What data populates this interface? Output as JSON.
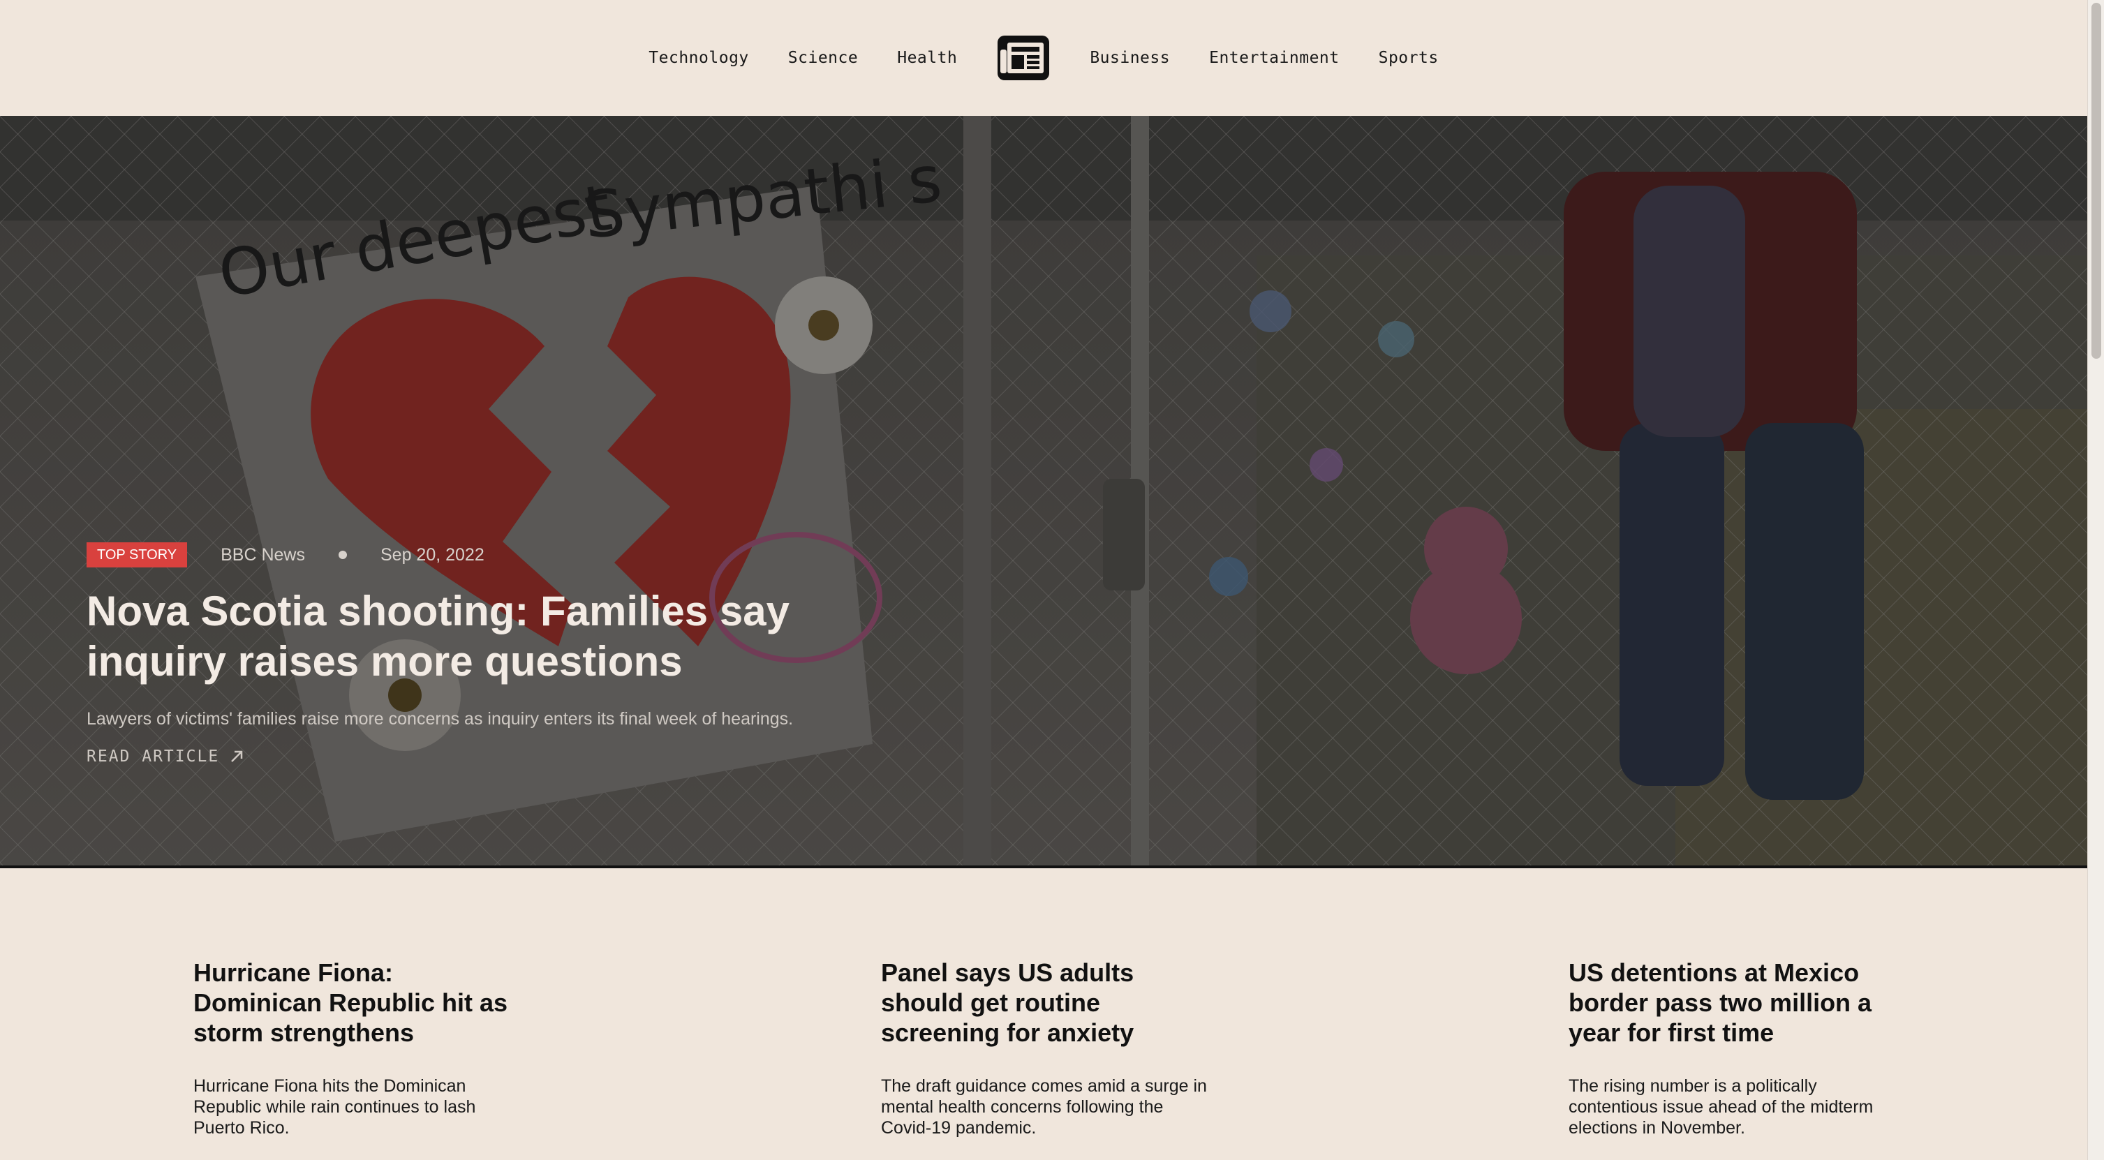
{
  "nav": {
    "left_items": [
      "Technology",
      "Science",
      "Health"
    ],
    "right_items": [
      "Business",
      "Entertainment",
      "Sports"
    ],
    "logo_icon": "newspaper-icon"
  },
  "hero": {
    "badge": "TOP STORY",
    "source": "BBC News",
    "date": "Sep 20, 2022",
    "title": "Nova Scotia shooting: Families say inquiry raises more questions",
    "description": "Lawyers of victims' families raise more concerns as inquiry enters its final week of hearings.",
    "read_label": "READ ARTICLE",
    "read_icon": "arrow-up-right-icon",
    "sign_text_1": "Our deepest",
    "sign_text_2": "Sympathies",
    "badge_color": "#d9413e"
  },
  "articles": [
    {
      "title": "Hurricane Fiona: Dominican Republic hit as storm strengthens",
      "description": "Hurricane Fiona hits the Dominican Republic while rain continues to lash Puerto Rico."
    },
    {
      "title": "Panel says US adults should get routine screening for anxiety",
      "description": "The draft guidance comes amid a surge in mental health concerns following the Covid-19 pandemic."
    },
    {
      "title": "US detentions at Mexico border pass two million a year for first time",
      "description": "The rising number is a politically contentious issue ahead of the midterm elections in November."
    }
  ]
}
